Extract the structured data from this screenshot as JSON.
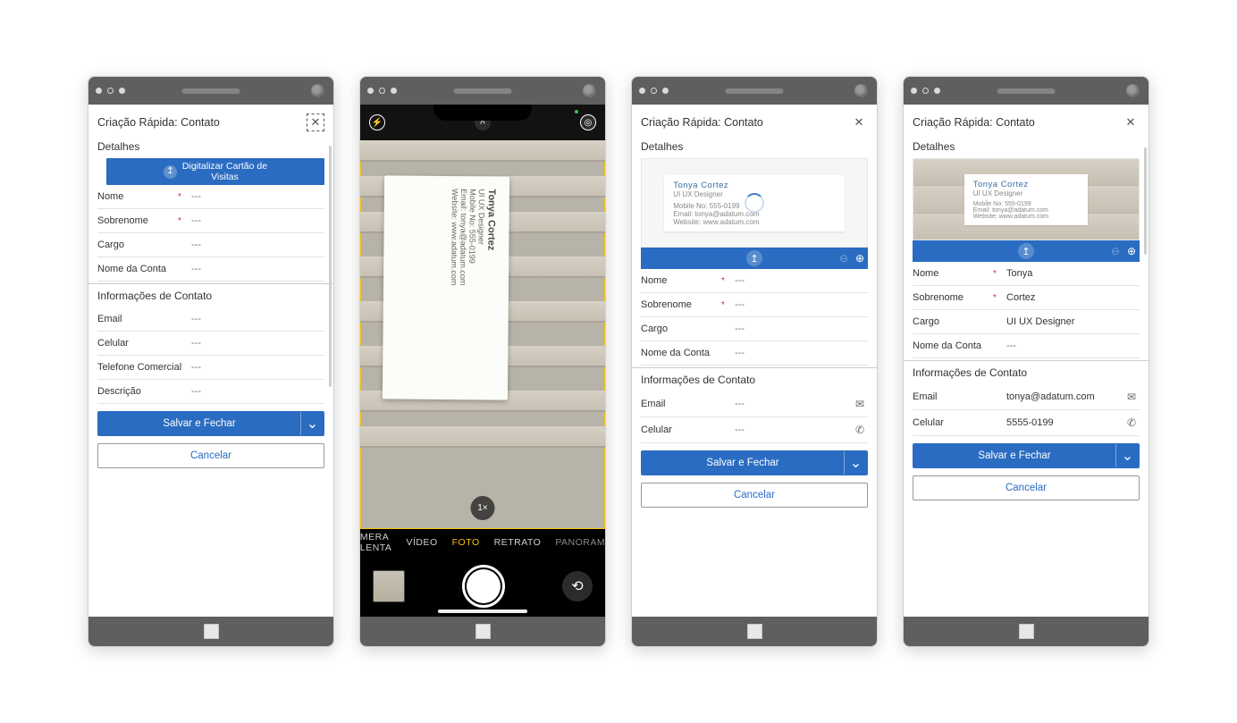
{
  "common": {
    "title": "Criação Rápida: Contato",
    "details": "Detalhes",
    "contact_info": "Informações de Contato",
    "save_close": "Salvar e Fechar",
    "cancel": "Cancelar",
    "empty": "---",
    "labels": {
      "nome": "Nome",
      "sobrenome": "Sobrenome",
      "cargo": "Cargo",
      "conta": "Nome da Conta",
      "email": "Email",
      "celular": "Celular",
      "tel_com": "Telefone Comercial",
      "descricao": "Descrição"
    }
  },
  "phone1": {
    "scan_button": "Digitalizar Cartão de\nVisitas"
  },
  "business_card": {
    "name": "Tonya Cortez",
    "title": "UI UX Designer",
    "mobile_line": "Mobile No: 555-0199",
    "email_line": "Email: tonya@adatum.com",
    "web_line": "Website: www.adatum.com"
  },
  "camera": {
    "modes": {
      "slow": "LENTA",
      "slow_prefix": "MERA",
      "video": "VÍDEO",
      "photo": "FOTO",
      "portrait": "RETRATO",
      "pano": "PANORAM"
    },
    "zoom": "1×"
  },
  "phone4": {
    "nome": "Tonya",
    "sobrenome": "Cortez",
    "cargo": "UI UX Designer",
    "email": "tonya@adatum.com",
    "celular": "5555-0199"
  }
}
